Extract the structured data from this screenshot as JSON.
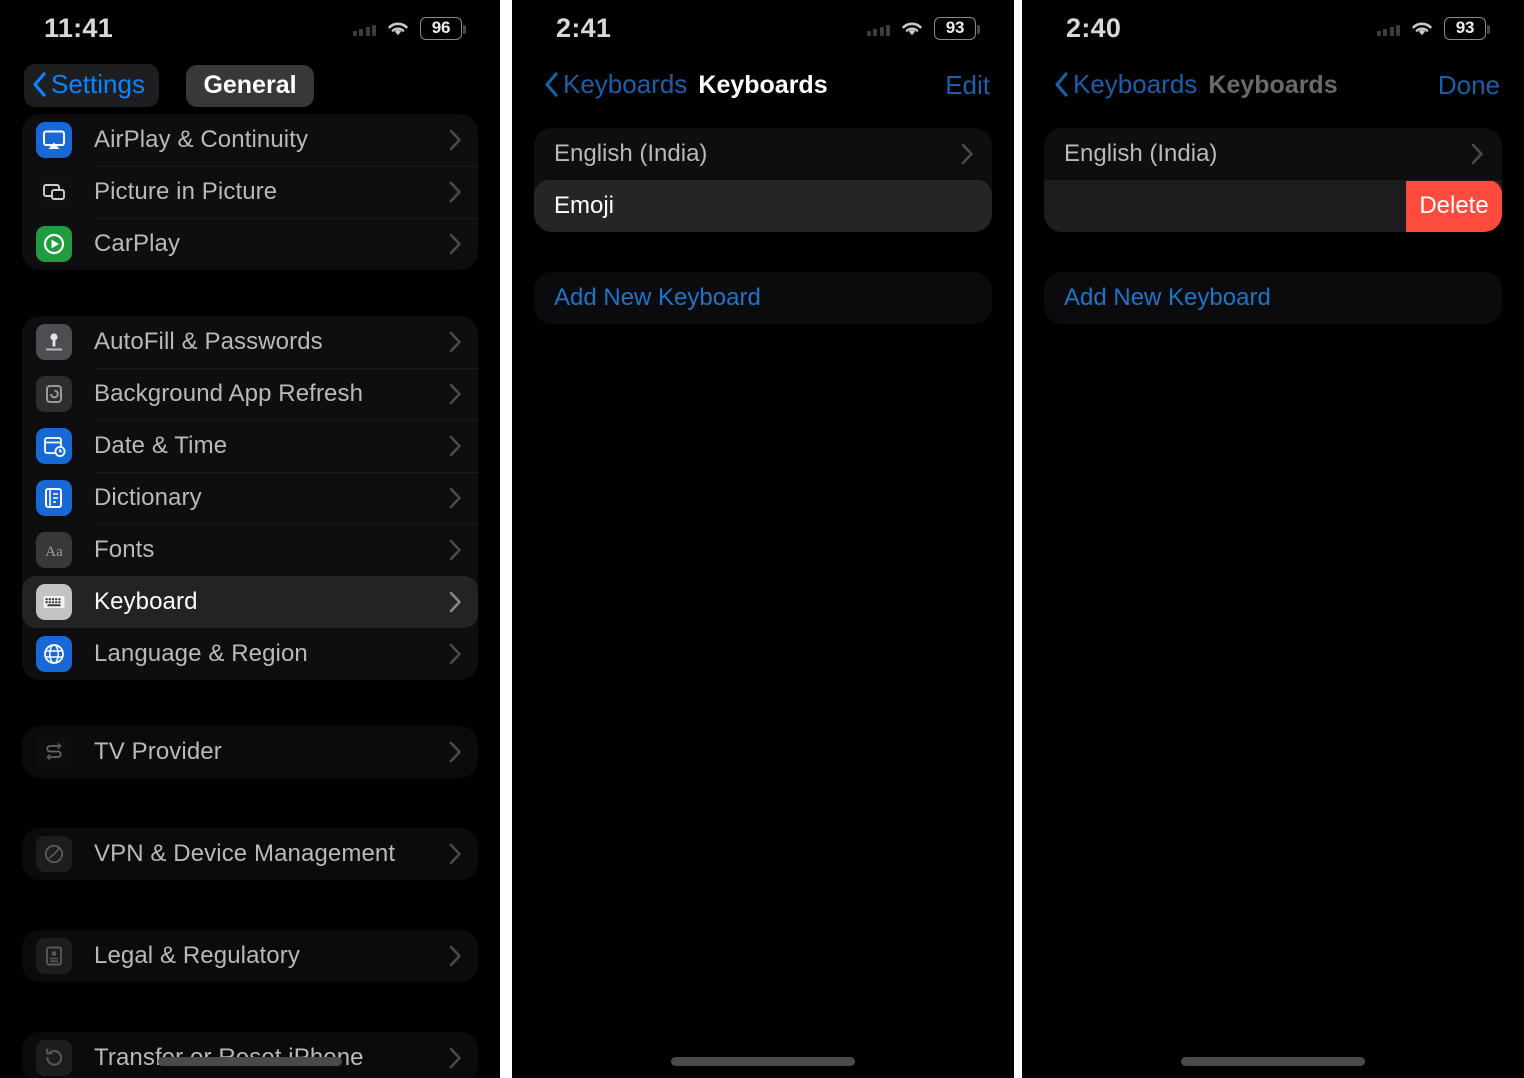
{
  "panels": [
    {
      "id": "general-settings",
      "statusbar": {
        "time": "11:41",
        "battery": "96",
        "wifi_icon": "wifi-icon",
        "cellular_icon": "cellular-bars-icon"
      },
      "nav": {
        "back_label": "Settings",
        "title": "General",
        "back_icon": "chevron-left-icon"
      },
      "sections": [
        {
          "rows": [
            {
              "label": "AirPlay & Continuity",
              "icon": "airplay-icon",
              "selected": false
            },
            {
              "label": "Picture in Picture",
              "icon": "picture-in-picture-icon",
              "selected": false
            },
            {
              "label": "CarPlay",
              "icon": "carplay-icon",
              "selected": false
            }
          ]
        },
        {
          "rows": [
            {
              "label": "AutoFill & Passwords",
              "icon": "key-icon",
              "selected": false
            },
            {
              "label": "Background App Refresh",
              "icon": "refresh-icon",
              "selected": false
            },
            {
              "label": "Date & Time",
              "icon": "calendar-clock-icon",
              "selected": false
            },
            {
              "label": "Dictionary",
              "icon": "book-icon",
              "selected": false
            },
            {
              "label": "Fonts",
              "icon": "fonts-aa-icon",
              "selected": false
            },
            {
              "label": "Keyboard",
              "icon": "keyboard-icon",
              "selected": true
            },
            {
              "label": "Language & Region",
              "icon": "globe-icon",
              "selected": false
            }
          ]
        },
        {
          "rows": [
            {
              "label": "TV Provider",
              "icon": "tv-provider-icon",
              "selected": false
            }
          ]
        },
        {
          "rows": [
            {
              "label": "VPN & Device Management",
              "icon": "vpn-icon",
              "selected": false
            }
          ]
        },
        {
          "rows": [
            {
              "label": "Legal & Regulatory",
              "icon": "legal-icon",
              "selected": false
            }
          ]
        },
        {
          "rows": [
            {
              "label": "Transfer or Reset iPhone",
              "icon": "reset-icon",
              "selected": false
            }
          ]
        }
      ]
    },
    {
      "id": "keyboards-list",
      "statusbar": {
        "time": "2:41",
        "battery": "93",
        "wifi_icon": "wifi-icon",
        "cellular_icon": "cellular-bars-icon"
      },
      "nav": {
        "back_label": "Keyboards",
        "title": "Keyboards",
        "action_label": "Edit",
        "back_icon": "chevron-left-icon"
      },
      "keyboards": [
        {
          "label": "English (India)",
          "highlighted": false,
          "chevron": true
        },
        {
          "label": "Emoji",
          "highlighted": true,
          "chevron": false
        }
      ],
      "add_row": {
        "label": "Add New Keyboard"
      }
    },
    {
      "id": "keyboards-edit",
      "statusbar": {
        "time": "2:40",
        "battery": "93",
        "wifi_icon": "wifi-icon",
        "cellular_icon": "cellular-bars-icon"
      },
      "nav": {
        "back_label": "Keyboards",
        "title": "Keyboards",
        "action_label": "Done",
        "back_icon": "chevron-left-icon"
      },
      "keyboards": [
        {
          "label": "English (India)",
          "highlighted": false,
          "chevron": true
        }
      ],
      "delete_row": {
        "button_label": "Delete"
      },
      "add_row": {
        "label": "Add New Keyboard"
      }
    }
  ],
  "colors": {
    "accent_blue": "#0a84ff",
    "destructive_red": "#fd4b3e",
    "card_background": "#0e0e10",
    "selected_row": "#232326",
    "page_background": "#000000"
  }
}
